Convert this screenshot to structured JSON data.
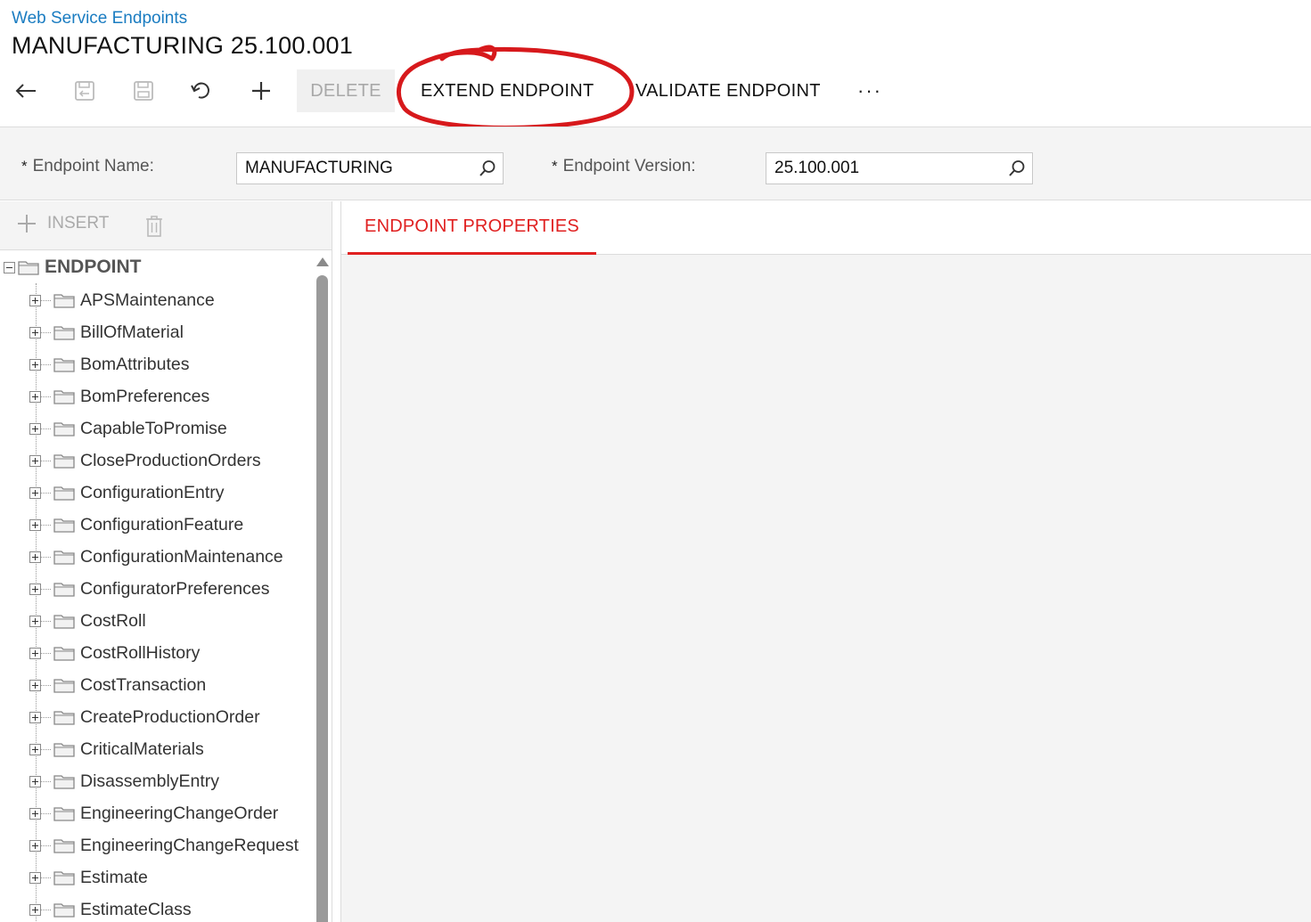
{
  "header": {
    "breadcrumb": "Web Service Endpoints",
    "title": "MANUFACTURING 25.100.001"
  },
  "toolbar": {
    "back_icon": "back-arrow-icon",
    "save_close_icon": "save-and-close-icon",
    "save_icon": "save-icon",
    "undo_icon": "undo-icon",
    "add_icon": "add-icon",
    "delete_label": "DELETE",
    "extend_label": "EXTEND ENDPOINT",
    "validate_label": "VALIDATE ENDPOINT",
    "more_label": "···",
    "annotation_color": "#d7191c"
  },
  "form": {
    "endpoint_name": {
      "label": "Endpoint Name:",
      "required_mark": "*",
      "value": "MANUFACTURING"
    },
    "endpoint_version": {
      "label": "Endpoint Version:",
      "required_mark": "*",
      "value": "25.100.001"
    }
  },
  "tree_toolbar": {
    "insert_label": "INSERT",
    "insert_icon": "plus-icon",
    "delete_icon": "trash-icon"
  },
  "tree": {
    "root": "ENDPOINT",
    "items": [
      "APSMaintenance",
      "BillOfMaterial",
      "BomAttributes",
      "BomPreferences",
      "CapableToPromise",
      "CloseProductionOrders",
      "ConfigurationEntry",
      "ConfigurationFeature",
      "ConfigurationMaintenance",
      "ConfiguratorPreferences",
      "CostRoll",
      "CostRollHistory",
      "CostTransaction",
      "CreateProductionOrder",
      "CriticalMaterials",
      "DisassemblyEntry",
      "EngineeringChangeOrder",
      "EngineeringChangeRequest",
      "Estimate",
      "EstimateClass"
    ]
  },
  "tabs": {
    "active_label": "ENDPOINT PROPERTIES",
    "accent_color": "#e02020"
  }
}
